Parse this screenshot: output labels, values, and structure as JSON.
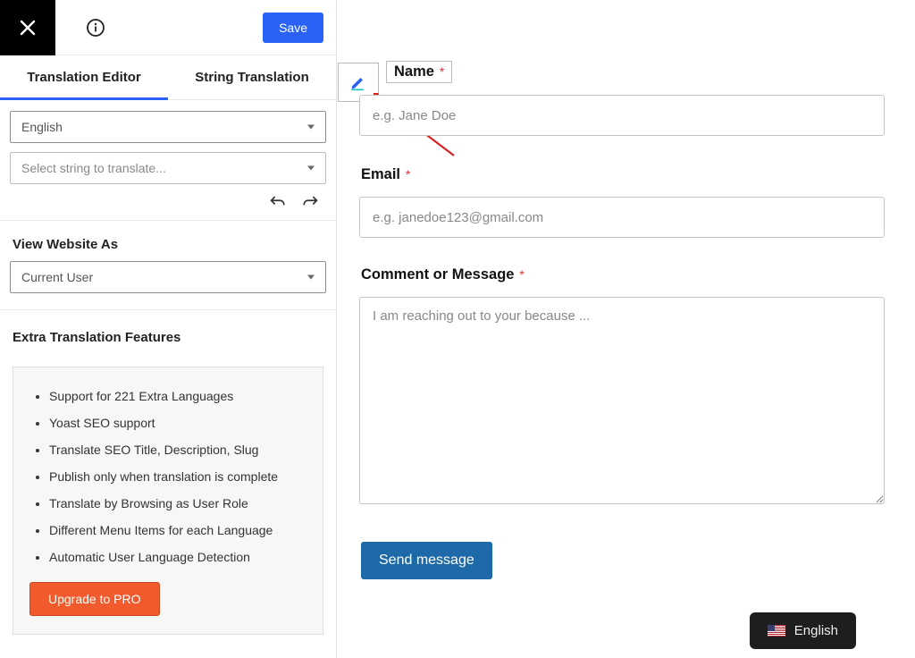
{
  "toolbar": {
    "save_label": "Save"
  },
  "tabs": {
    "editor": "Translation Editor",
    "string": "String Translation"
  },
  "selects": {
    "language": "English",
    "string_placeholder": "Select string to translate..."
  },
  "view_as": {
    "title": "View Website As",
    "value": "Current User"
  },
  "features": {
    "title": "Extra Translation Features",
    "items": [
      "Support for 221 Extra Languages",
      "Yoast SEO support",
      "Translate SEO Title, Description, Slug",
      "Publish only when translation is complete",
      "Translate by Browsing as User Role",
      "Different Menu Items for each Language",
      "Automatic User Language Detection"
    ],
    "upgrade_label": "Upgrade to PRO"
  },
  "form": {
    "name_label": "Name",
    "name_placeholder": "e.g. Jane Doe",
    "email_label": "Email",
    "email_placeholder": "e.g. janedoe123@gmail.com",
    "message_label": "Comment or Message",
    "message_placeholder": "I am reaching out to your because ...",
    "submit_label": "Send message"
  },
  "lang_switch": {
    "label": "English"
  }
}
